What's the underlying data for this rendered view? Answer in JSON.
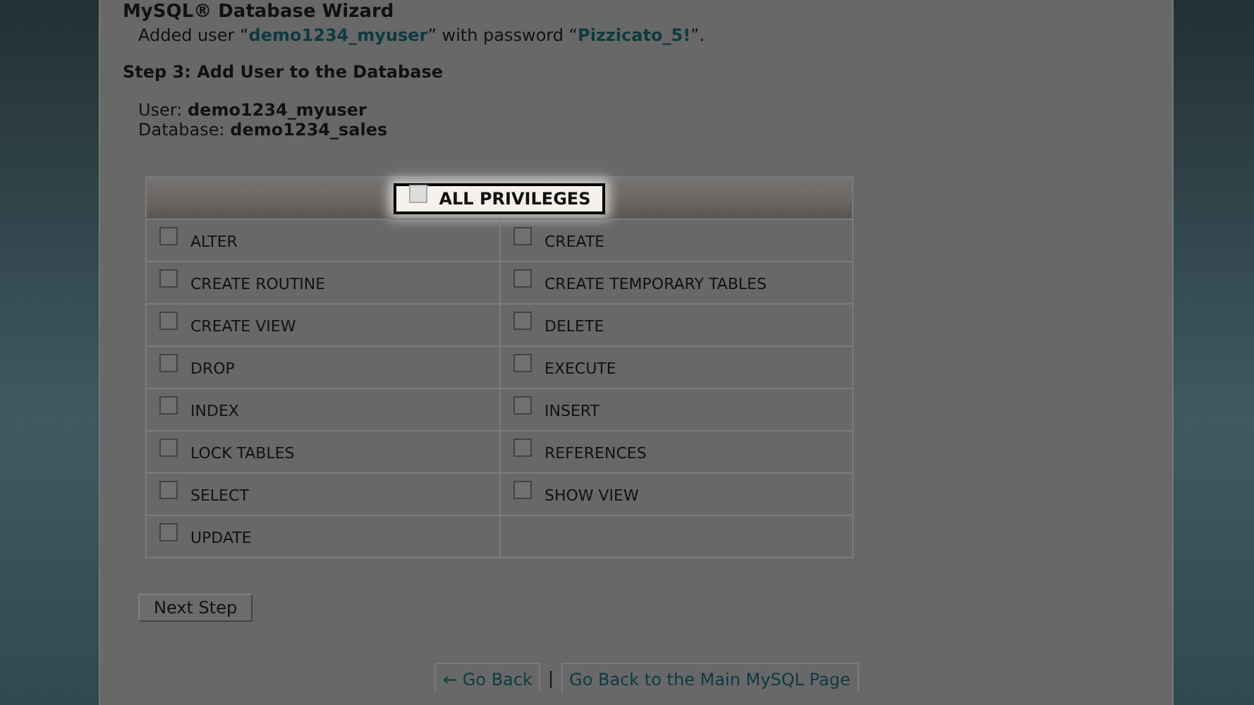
{
  "page_title": "MySQL® Database Wizard",
  "notice": {
    "prefix": "Added user “",
    "user": "demo1234_myuser",
    "middle": "” with password “",
    "password": "Pizzicato_5!",
    "suffix": "”."
  },
  "step_heading": "Step 3: Add User to the Database",
  "details": [
    {
      "label": "User:",
      "value": "demo1234_myuser"
    },
    {
      "label": "Database:",
      "value": "demo1234_sales"
    }
  ],
  "all_privileges": {
    "label": "ALL PRIVILEGES",
    "checked": false
  },
  "privileges": [
    {
      "label": "ALTER",
      "checked": false
    },
    {
      "label": "CREATE",
      "checked": false
    },
    {
      "label": "CREATE ROUTINE",
      "checked": false
    },
    {
      "label": "CREATE TEMPORARY TABLES",
      "checked": false
    },
    {
      "label": "CREATE VIEW",
      "checked": false
    },
    {
      "label": "DELETE",
      "checked": false
    },
    {
      "label": "DROP",
      "checked": false
    },
    {
      "label": "EXECUTE",
      "checked": false
    },
    {
      "label": "INDEX",
      "checked": false
    },
    {
      "label": "INSERT",
      "checked": false
    },
    {
      "label": "LOCK TABLES",
      "checked": false
    },
    {
      "label": "REFERENCES",
      "checked": false
    },
    {
      "label": "SELECT",
      "checked": false
    },
    {
      "label": "SHOW VIEW",
      "checked": false
    },
    {
      "label": "UPDATE",
      "checked": false
    }
  ],
  "next_button": "Next Step",
  "footer_links": [
    {
      "label": "← Go Back"
    },
    {
      "label": "Go Back to the Main MySQL Page"
    }
  ],
  "footer_separator": "|"
}
